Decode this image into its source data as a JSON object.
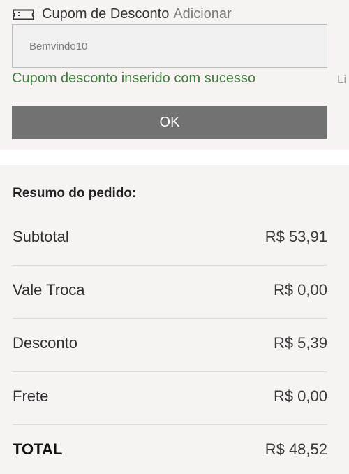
{
  "coupon": {
    "title": "Cupom de Desconto",
    "add_label": "Adicionar",
    "input_value": "Bemvindo10",
    "success_message": "Cupom desconto inserido com sucesso",
    "side_link": "Li",
    "ok_label": "OK",
    "icon": "ticket-icon"
  },
  "summary": {
    "heading": "Resumo do pedido:",
    "rows": [
      {
        "label": "Subtotal",
        "value": "R$ 53,91"
      },
      {
        "label": "Vale Troca",
        "value": "R$ 0,00"
      },
      {
        "label": "Desconto",
        "value": "R$ 5,39"
      },
      {
        "label": "Frete",
        "value": "R$ 0,00"
      },
      {
        "label": "TOTAL",
        "value": "R$ 48,52"
      }
    ]
  },
  "colors": {
    "success": "#3f7d3c",
    "button": "#727272",
    "panel_background": "#f7f3f3"
  }
}
